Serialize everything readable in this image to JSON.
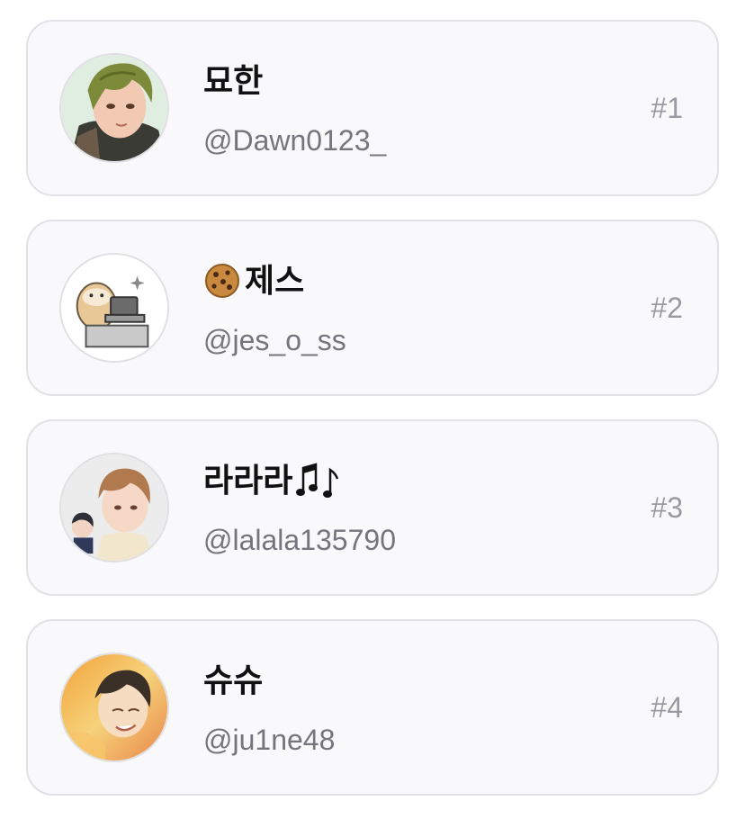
{
  "users": [
    {
      "name": "묘한",
      "name_prefix_icon": "",
      "name_suffix_icon": "",
      "handle": "@Dawn0123_",
      "rank": "#1",
      "avatar_icon": "avatar-anime-green-hair"
    },
    {
      "name": "제스",
      "name_prefix_icon": "cookie-emoji",
      "name_suffix_icon": "",
      "handle": "@jes_o_ss",
      "rank": "#2",
      "avatar_icon": "avatar-hamster-laptop"
    },
    {
      "name": "라라라",
      "name_prefix_icon": "",
      "name_suffix_icon": "music-notes-emoji",
      "handle": "@lalala135790",
      "rank": "#3",
      "avatar_icon": "avatar-anime-brown-hair"
    },
    {
      "name": "슈슈",
      "name_prefix_icon": "",
      "name_suffix_icon": "",
      "handle": "@ju1ne48",
      "rank": "#4",
      "avatar_icon": "avatar-anime-sunset"
    }
  ],
  "colors": {
    "card_bg": "#f9f9fb",
    "card_border": "#e1e1e6",
    "name": "#111111",
    "handle": "#75757d",
    "rank": "#9a9aa2"
  }
}
